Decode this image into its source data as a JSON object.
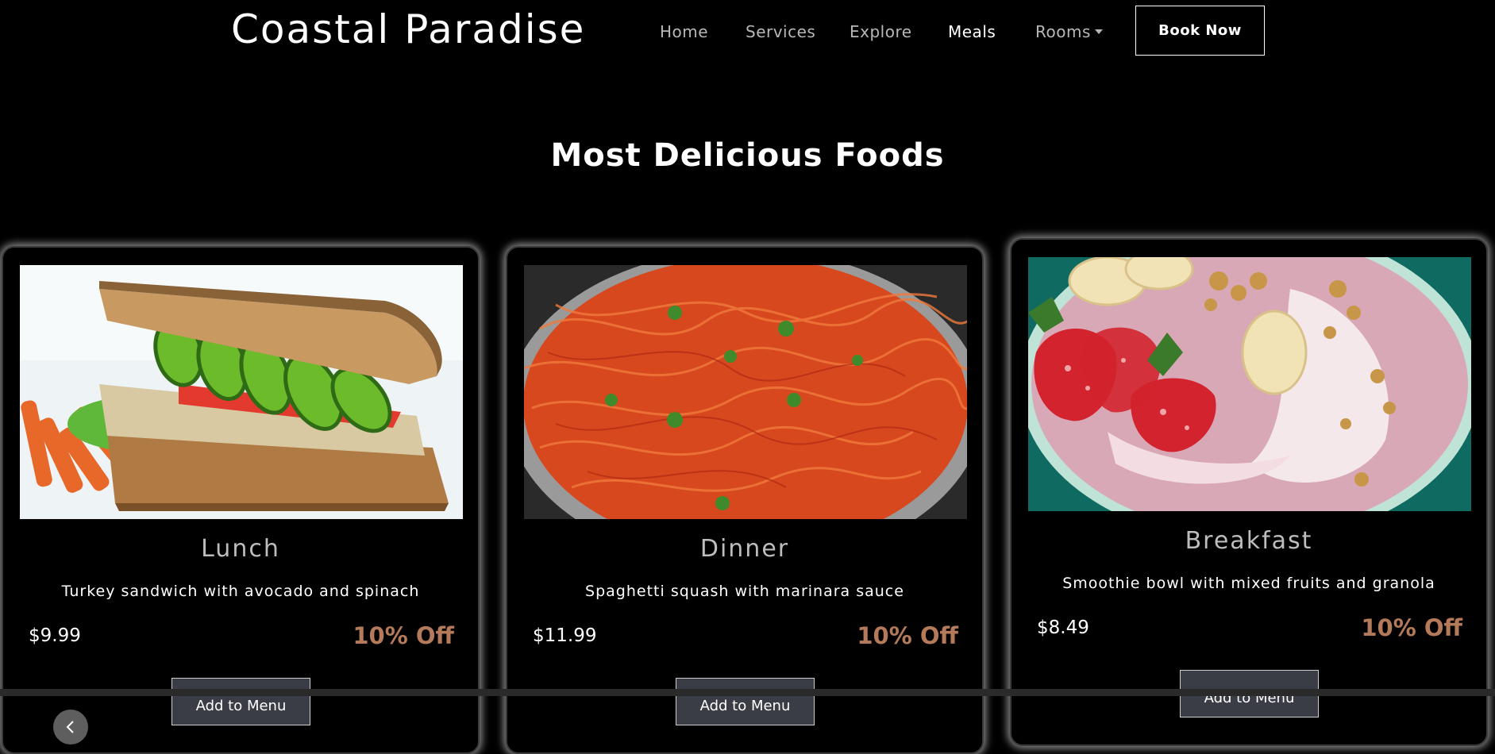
{
  "brand": "Coastal Paradise",
  "nav": {
    "home": "Home",
    "services": "Services",
    "explore": "Explore",
    "meals": "Meals",
    "rooms": "Rooms",
    "book_now": "Book Now",
    "active": "Meals"
  },
  "section_title": "Most Delicious Foods",
  "cards": [
    {
      "title": "Lunch",
      "desc": "Turkey sandwich with avocado and spinach",
      "price": "$9.99",
      "discount": "10% Off",
      "button": "Add to Menu",
      "image_icon": "sandwich-image"
    },
    {
      "title": "Dinner",
      "desc": "Spaghetti squash with marinara sauce",
      "price": "$11.99",
      "discount": "10% Off",
      "button": "Add to Menu",
      "image_icon": "spaghetti-image"
    },
    {
      "title": "Breakfast",
      "desc": "Smoothie bowl with mixed fruits and granola",
      "price": "$8.49",
      "discount": "10% Off",
      "button": "Add to Menu",
      "image_icon": "smoothie-bowl-image"
    }
  ],
  "colors": {
    "background": "#000000",
    "discount": "#b47a5a",
    "button": "#3a3d45"
  }
}
